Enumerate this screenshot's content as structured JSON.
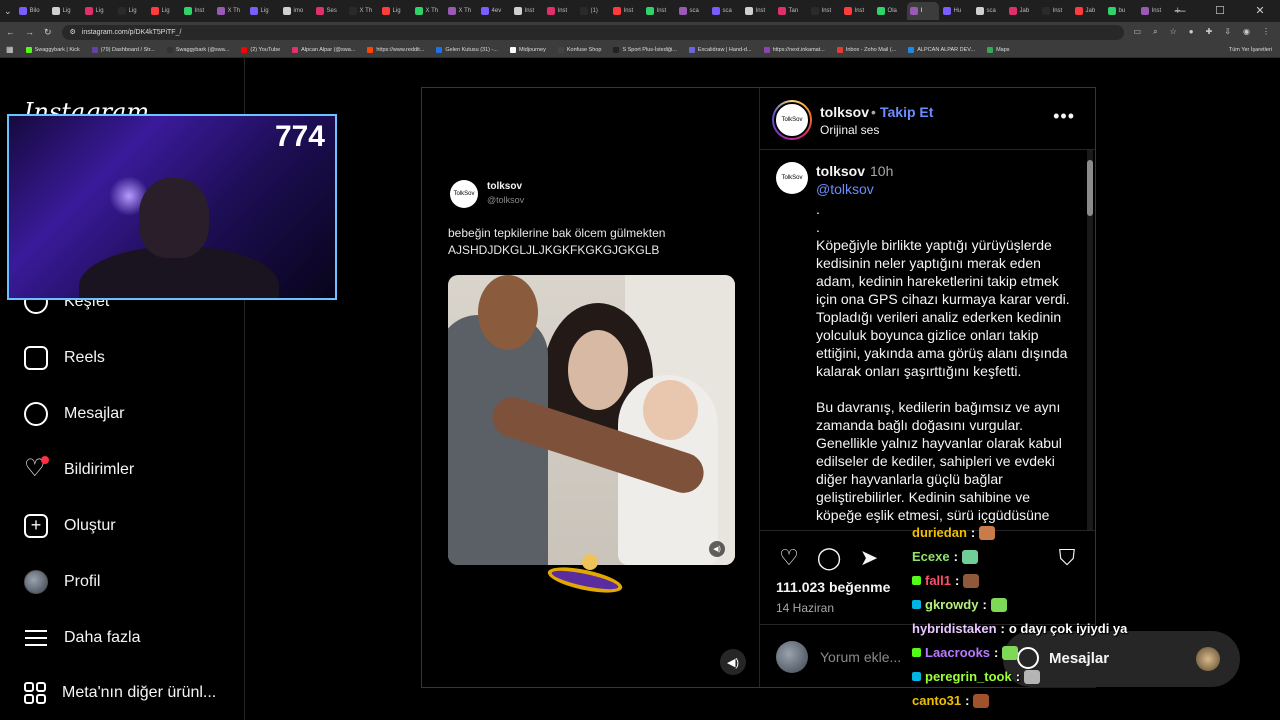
{
  "browser": {
    "tabs": [
      "Bilo",
      "Lig",
      "Lig",
      "Lig",
      "Lig",
      "Inst",
      "X Th",
      "Lig",
      "imo",
      "Ses",
      "X Th",
      "Lig",
      "X Th",
      "X Th",
      "4ev",
      "Inst",
      "Inst",
      "(1)",
      "Inst",
      "Inst",
      "sca",
      "sca",
      "Inst",
      "Tan",
      "Inst",
      "Inst",
      "Ola",
      "I",
      "Hu",
      "sca",
      "Jab",
      "Inst",
      "Jab",
      "bu",
      "Inst"
    ],
    "active_tab_index": 27,
    "url": "instagram.com/p/DK4kT5PiTF_/",
    "bookmarks": [
      "Swaggybark | Kick",
      "(79) Dashboard / Str...",
      "Swaggybark (@swa...",
      "(2) YouTube",
      "Alpcan Alpar (@swa...",
      "https://www.reddit...",
      "Gelen Kutusu (31) -...",
      "Midjourney",
      "Konfuse Shop",
      "S Sport Plus-İstediği...",
      "Excalidraw | Hand-d...",
      "https://next.inkamat...",
      "Inbox - Zoho Mail (...",
      "ALPCAN ALPAR DEV...",
      "Maps"
    ],
    "bookmarks_right": "Tüm Yer İşaretleri"
  },
  "sidebar": {
    "logo": "Instagram",
    "items": [
      {
        "label": "Keşfet",
        "icon": "compass-icon"
      },
      {
        "label": "Reels",
        "icon": "reels-icon"
      },
      {
        "label": "Mesajlar",
        "icon": "messenger-icon"
      },
      {
        "label": "Bildirimler",
        "icon": "heart-icon"
      },
      {
        "label": "Oluştur",
        "icon": "plus-square-icon"
      },
      {
        "label": "Profil",
        "icon": "avatar"
      },
      {
        "label": "Daha fazla",
        "icon": "menu-icon"
      },
      {
        "label": "Meta'nın diğer ürünl...",
        "icon": "meta-apps-icon"
      }
    ]
  },
  "webcam": {
    "counter": "774"
  },
  "post": {
    "tweet": {
      "avatar_text": "TolkSov",
      "name": "tolksov",
      "handle": "@tolksov",
      "text": "bebeğin tepkilerine bak ölcem gülmekten AJSHDJDKGLJLJKGKFKGKGJGKGLB"
    },
    "header": {
      "avatar_text": "TolkSov",
      "username": "tolksov",
      "dot": "•",
      "follow": "Takip Et",
      "audio": "Orijinal ses"
    },
    "caption": {
      "avatar_text": "TolkSov",
      "username": "tolksov",
      "time": "10h",
      "handle": "@tolksov",
      "text": ".\n.\nKöpeğiyle birlikte yaptığı yürüyüşlerde kedisinin neler yaptığını merak eden adam, kedinin hareketlerini takip etmek için ona GPS cihazı kurmaya karar verdi. Topladığı verileri analiz ederken kedinin yolculuk boyunca gizlice onları takip ettiğini, yakında ama görüş alanı dışında kalarak onları şaşırttığını keşfetti.\n\nBu davranış, kedilerin bağımsız ve aynı zamanda bağlı doğasını vurgular. Genellikle yalnız hayvanlar olarak kabul edilseler de kediler, sahipleri ve evdeki diğer hayvanlarla güçlü bağlar geliştirebilirler. Kedinin sahibine ve köpeğe eşlik etmesi, sürü içgüdüsüne"
    },
    "likes": "111.023 beğenme",
    "date": "14 Haziran",
    "comment_placeholder": "Yorum ekle..."
  },
  "chat": [
    {
      "user": "duriedan",
      "sep": ":",
      "msg": "",
      "color": "#f0c000"
    },
    {
      "user": "Ecexe",
      "sep": ":",
      "msg": "",
      "color": "#8fe36a"
    },
    {
      "user": "fall1",
      "sep": ":",
      "msg": "",
      "color": "#ff4f6a"
    },
    {
      "user": "gkrowdy",
      "sep": ":",
      "msg": "",
      "color": "#b4f07a"
    },
    {
      "user": "hybridistaken",
      "sep": ":",
      "msg": "o dayı çok iyiydi ya",
      "color": "#e9c7ff"
    },
    {
      "user": "Laacrooks",
      "sep": ":",
      "msg": "",
      "color": "#b879ff"
    },
    {
      "user": "peregrin_took",
      "sep": ":",
      "msg": "",
      "color": "#9dff3b"
    },
    {
      "user": "canto31",
      "sep": ":",
      "msg": "",
      "color": "#f0c000"
    }
  ],
  "messages_pill": {
    "label": "Mesajlar"
  },
  "colors": {
    "accent_blue": "#6a8eff",
    "notification_red": "#ff3040",
    "webcam_border": "#6cc2ff"
  }
}
